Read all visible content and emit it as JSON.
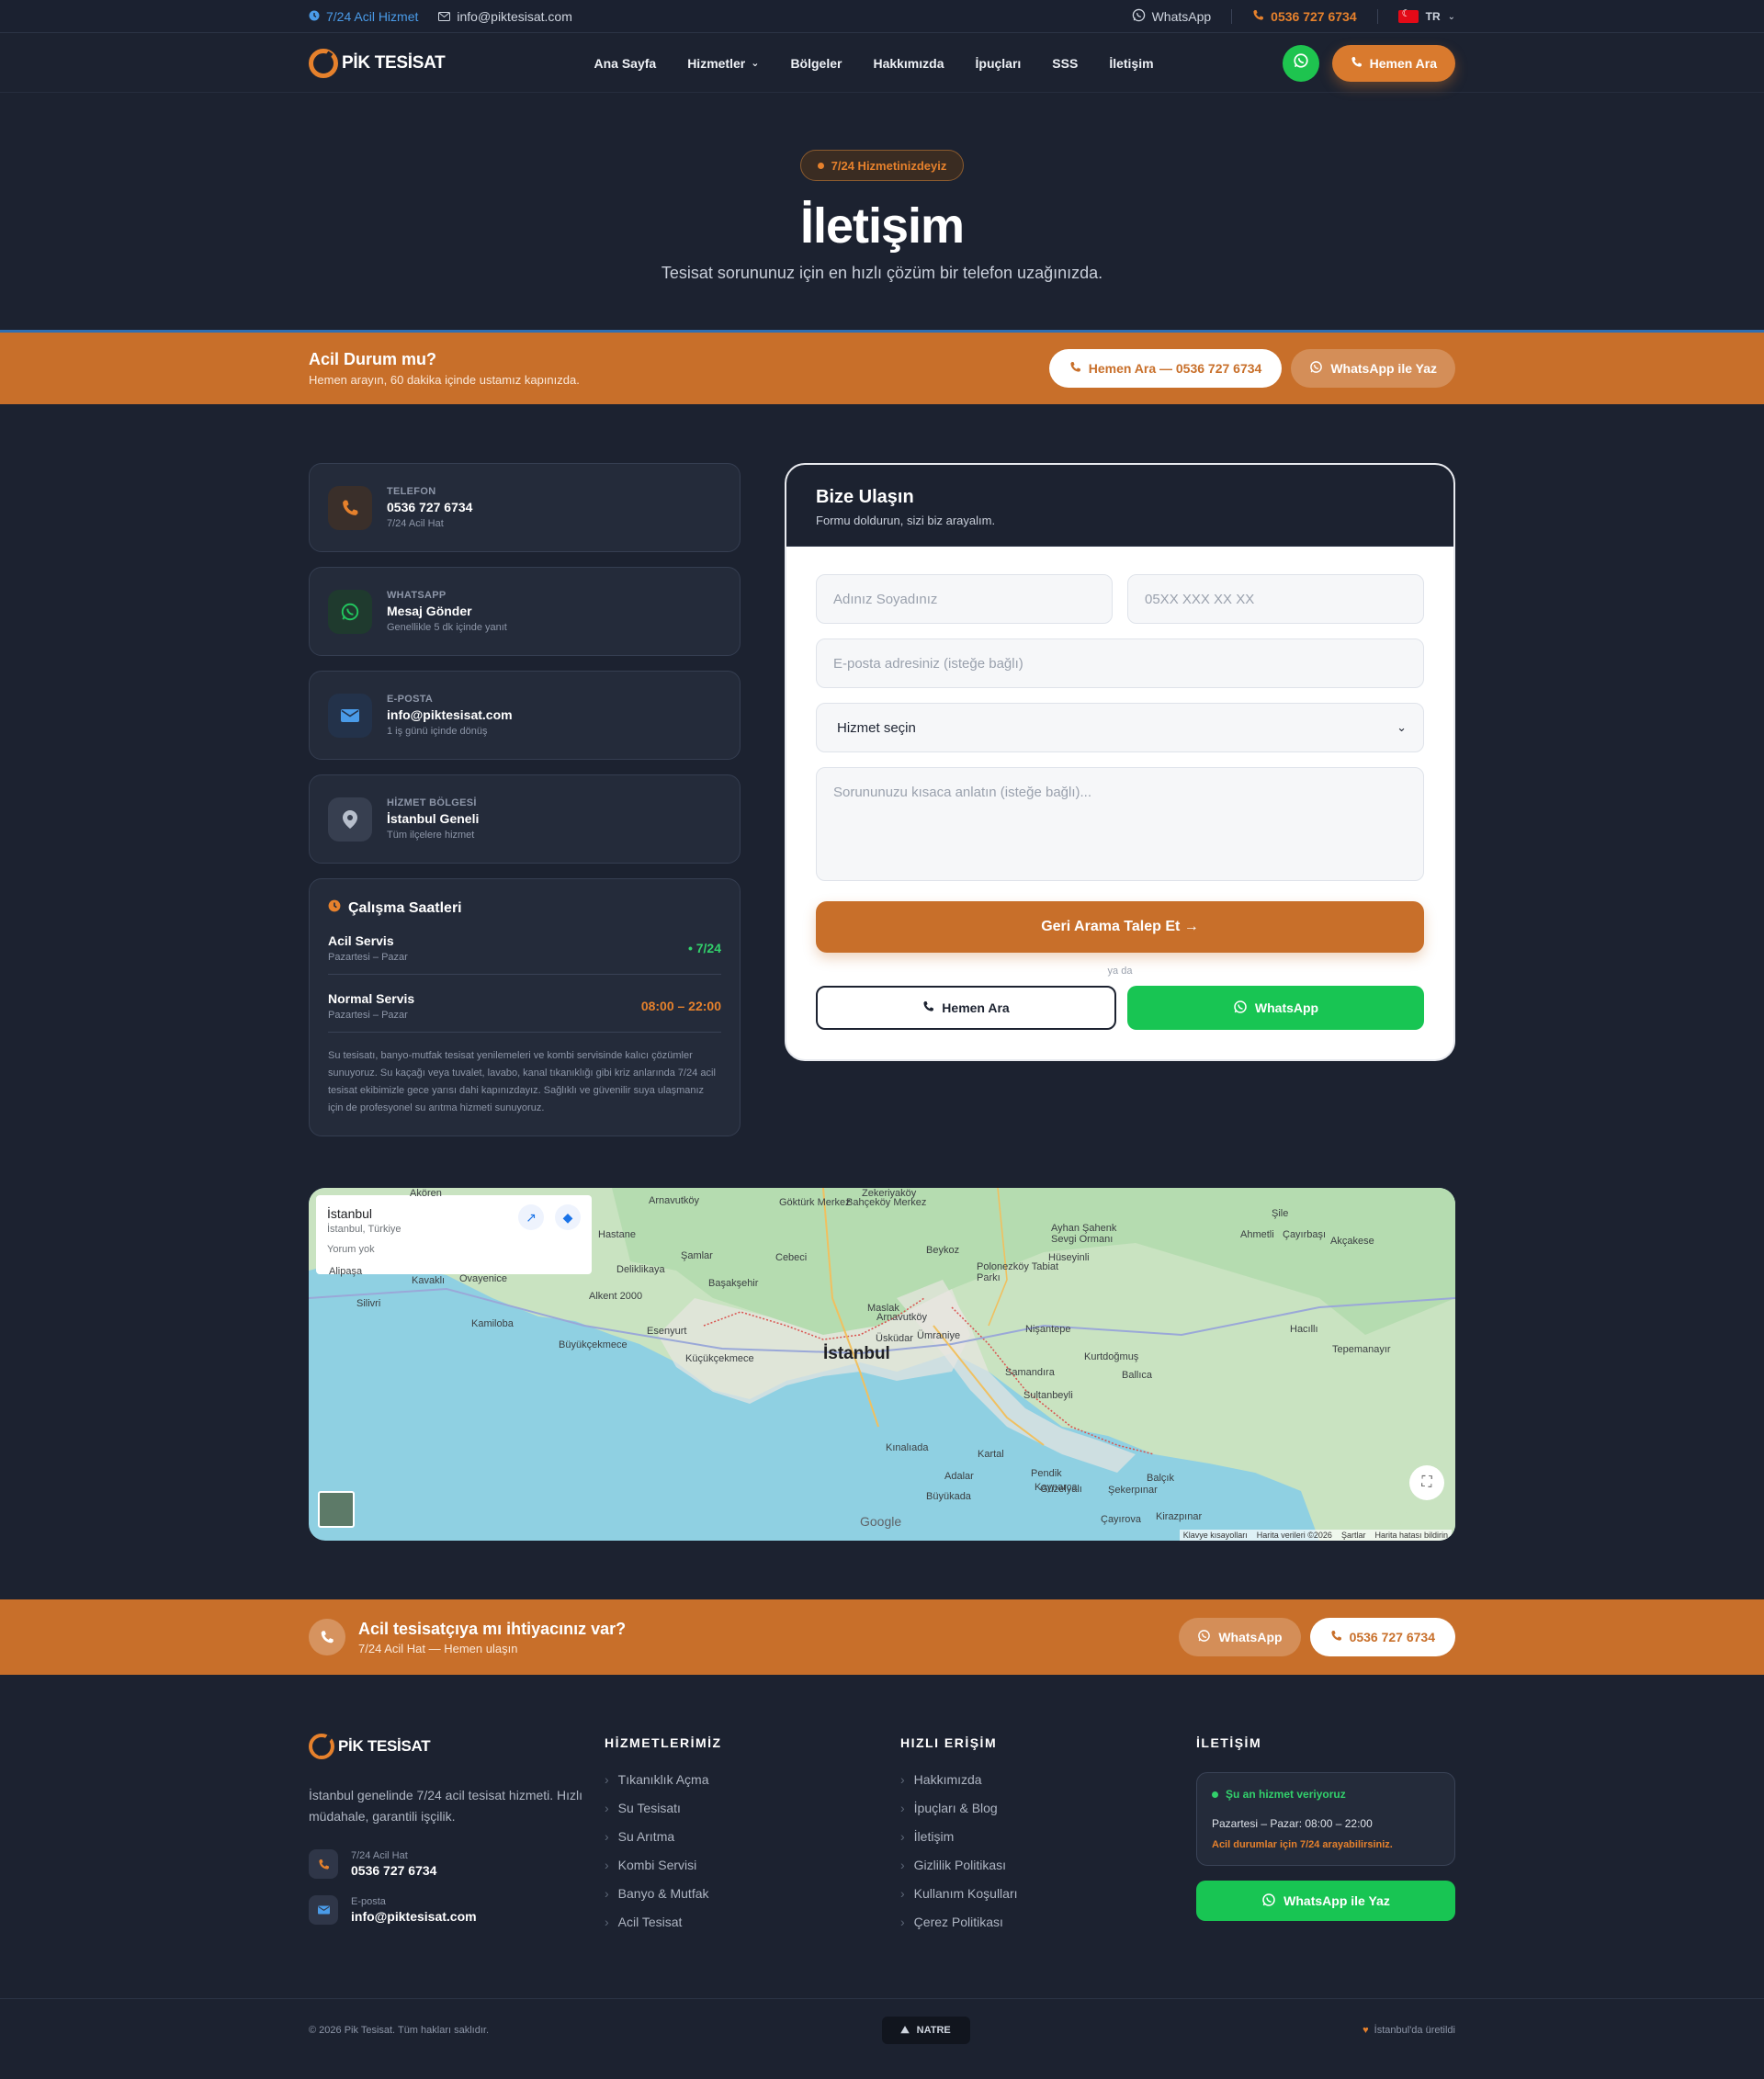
{
  "topbar": {
    "emergency": "7/24 Acil Hizmet",
    "email": "info@piktesisat.com",
    "whatsapp": "WhatsApp",
    "phone": "0536 727 6734",
    "lang": "TR"
  },
  "nav": {
    "logo": "PİK TESİSAT",
    "items": [
      "Ana Sayfa",
      "Hizmetler",
      "Bölgeler",
      "Hakkımızda",
      "İpuçları",
      "SSS",
      "İletişim"
    ],
    "cta": "Hemen Ara"
  },
  "hero": {
    "badge": "7/24 Hizmetinizdeyiz",
    "title": "İletişim",
    "subtitle": "Tesisat sorununuz için en hızlı çözüm bir telefon uzağınızda."
  },
  "emergency": {
    "title": "Acil Durum mu?",
    "subtitle": "Hemen arayın, 60 dakika içinde ustamız kapınızda.",
    "call_label": "Hemen Ara — 0536 727 6734",
    "wa_label": "WhatsApp ile Yaz"
  },
  "contact_cards": [
    {
      "label": "TELEFON",
      "value": "0536 727 6734",
      "sub": "7/24 Acil Hat",
      "icon": "phone-icon",
      "color": "#e6812c",
      "bg": "#3a2f2a"
    },
    {
      "label": "WHATSAPP",
      "value": "Mesaj Gönder",
      "sub": "Genellikle 5 dk içinde yanıt",
      "icon": "whatsapp-icon",
      "color": "#22c55e",
      "bg": "#1f3a2e"
    },
    {
      "label": "E-POSTA",
      "value": "info@piktesisat.com",
      "sub": "1 iş günü içinde dönüş",
      "icon": "mail-icon",
      "color": "#4a9be8",
      "bg": "#23324a"
    },
    {
      "label": "HİZMET BÖLGESİ",
      "value": "İstanbul Geneli",
      "sub": "Tüm ilçelere hizmet",
      "icon": "location-pin-icon",
      "color": "#b7bfcc",
      "bg": "#373f50"
    }
  ],
  "hours": {
    "title": "Çalışma Saatleri",
    "rows": [
      {
        "title": "Acil Servis",
        "sub": "Pazartesi – Pazar",
        "value": "• 7/24",
        "color": "#32d06b"
      },
      {
        "title": "Normal Servis",
        "sub": "Pazartesi – Pazar",
        "value": "08:00 – 22:00",
        "color": "#e6812c"
      }
    ],
    "desc": "Su tesisatı, banyo-mutfak tesisat yenilemeleri ve kombi servisinde kalıcı çözümler sunuyoruz. Su kaçağı veya tuvalet, lavabo, kanal tıkanıklığı gibi kriz anlarında 7/24 acil tesisat ekibimizle gece yarısı dahi kapınızdayız. Sağlıklı ve güvenilir suya ulaşmanız için de profesyonel su arıtma hizmeti sunuyoruz."
  },
  "form": {
    "title": "Bize Ulaşın",
    "subtitle": "Formu doldurun, sizi biz arayalım.",
    "name_ph": "Adınız Soyadınız",
    "phone_ph": "05XX XXX XX XX",
    "email_ph": "E-posta adresiniz (isteğe bağlı)",
    "service_value": "Hizmet seçin",
    "message_ph": "Sorununuzu kısaca anlatın (isteğe bağlı)...",
    "submit": "Geri Arama Talep Et →",
    "or": "ya da",
    "call": "Hemen Ara",
    "whatsapp": "WhatsApp"
  },
  "map": {
    "place": "İstanbul",
    "address": "İstanbul, Türkiye",
    "reviews": "Yorum yok",
    "city_label": "İstanbul",
    "labels": [
      "Arnavutköy",
      "Göktürk Merkez",
      "Bahçeköy Merkez",
      "Zekeriyaköy",
      "Hastane",
      "Deliklikaya",
      "Şamlar",
      "Cebeci",
      "Başakşehir",
      "Beykoz",
      "Polonezköy Tabiat Parkı",
      "Hüseyinli",
      "Ayhan Şahenk Sevgi Ormanı",
      "Şile",
      "Ahmetli",
      "Çayırbaşı",
      "Akçakese",
      "Kavaklı",
      "Ovayenice",
      "Silivri",
      "Alkent 2000",
      "Esenyurt",
      "Kamiloba",
      "Büyükçekmece",
      "Küçükçekmece",
      "Maslak",
      "Arnavutköy",
      "Üsküdar",
      "Ümraniye",
      "Nişantepe",
      "Kurtdoğmuş",
      "Ballıca",
      "Hacıllı",
      "Tepemanayır",
      "Samandıra",
      "Sultanbeyli",
      "Kınalıada",
      "Adalar",
      "Büyükada",
      "Kartal",
      "Pendik",
      "Kaynarca",
      "Balçık",
      "Güzelyalı",
      "Şekerpınar",
      "Çayırova",
      "Kirazpınar",
      "Akören",
      "Alipaşa"
    ],
    "footer": [
      "Klavye kısayolları",
      "Harita verileri ©2026",
      "Şartlar",
      "Harita hatası bildirin"
    ],
    "google": "Google"
  },
  "cta_band": {
    "title": "Acil tesisatçıya mı ihtiyacınız var?",
    "subtitle": "7/24 Acil Hat — Hemen ulaşın",
    "wa": "WhatsApp",
    "phone": "0536 727 6734"
  },
  "footer": {
    "logo": "PİK TESİSAT",
    "desc": "İstanbul genelinde 7/24 acil tesisat hizmeti. Hızlı müdahale, garantili işçilik.",
    "hotline_label": "7/24 Acil Hat",
    "hotline": "0536 727 6734",
    "email_label": "E-posta",
    "email": "info@piktesisat.com",
    "services_title": "HİZMETLERİMİZ",
    "services": [
      "Tıkanıklık Açma",
      "Su Tesisatı",
      "Su Arıtma",
      "Kombi Servisi",
      "Banyo & Mutfak",
      "Acil Tesisat"
    ],
    "quick_title": "HIZLI ERİŞİM",
    "quick": [
      "Hakkımızda",
      "İpuçları & Blog",
      "İletişim",
      "Gizlilik Politikası",
      "Kullanım Koşulları",
      "Çerez Politikası"
    ],
    "contact_title": "İLETİŞİM",
    "status": "Şu an hizmet veriyoruz",
    "hours": "Pazartesi – Pazar: 08:00 – 22:00",
    "urgent": "Acil durumlar için 7/24 arayabilirsiniz.",
    "wa": "WhatsApp ile Yaz",
    "copyright": "© 2026 Pik Tesisat. Tüm hakları saklıdır.",
    "maker": "NATRE",
    "made_in": "İstanbul'da üretildi"
  },
  "colors": {
    "accent": "#c86f2a",
    "accent_light": "#e6812c",
    "bg": "#1c2230",
    "whatsapp": "#18c553"
  }
}
